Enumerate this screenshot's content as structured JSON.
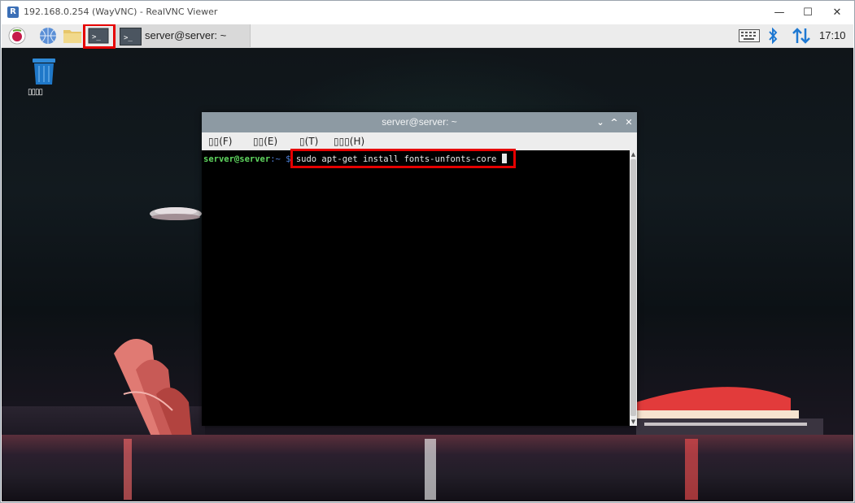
{
  "vnc": {
    "title": "192.168.0.254 (WayVNC) - RealVNC Viewer",
    "logo_letter": "R",
    "controls": {
      "minimize": "—",
      "maximize": "☐",
      "close": "✕"
    }
  },
  "panel": {
    "task_label": "server@server: ~",
    "clock": "17:10",
    "terminal_glyph": ">_"
  },
  "desktop": {
    "trash_label": "▯▯▯▯"
  },
  "terminal": {
    "title": "server@server: ~",
    "controls": {
      "minimize": "⌄",
      "maximize": "^",
      "close": "✕"
    },
    "menu": [
      {
        "label": "▯▯(F)"
      },
      {
        "label": "▯▯(E)"
      },
      {
        "label": "▯(T)"
      },
      {
        "label": "▯▯▯(H)"
      }
    ],
    "prompt_user": "server@server",
    "prompt_path": ":~ $",
    "command": "sudo apt-get install fonts-unfonts-core"
  },
  "colors": {
    "highlight": "#e60000",
    "prompt_user": "#5fd75f",
    "prompt_path": "#4f7fd6"
  }
}
